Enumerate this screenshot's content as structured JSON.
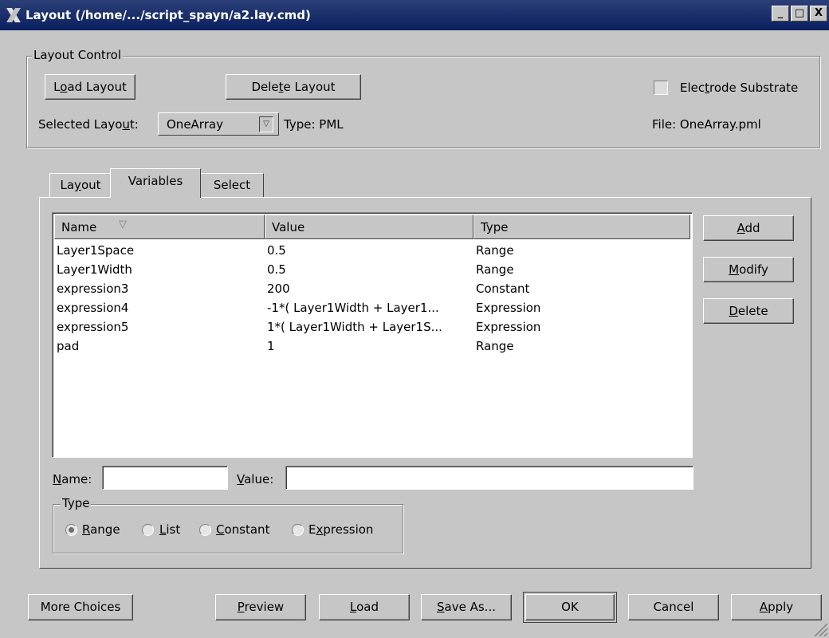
{
  "window": {
    "title": "Layout (/home/.../script_spayn/a2.lay.cmd)",
    "minimize": "_",
    "maximize": "□",
    "close": "X"
  },
  "layout_control": {
    "legend": "Layout Control",
    "load_layout": {
      "pre": "L",
      "u": "o",
      "post": "ad Layout"
    },
    "delete_layout": {
      "pre": "Dele",
      "u": "t",
      "post": "e Layout"
    },
    "electrode_substrate": {
      "pre": "Elec",
      "u": "t",
      "post": "rode Substrate"
    },
    "selected_layout_label": {
      "pre": "Selected Layo",
      "u": "u",
      "post": "t:"
    },
    "selected_layout_value": "OneArray",
    "type_text": "Type: PML",
    "file_text": "File: OneArray.pml"
  },
  "tabs": [
    {
      "pre": "La",
      "u": "y",
      "post": "out"
    },
    {
      "pre": "",
      "u": "",
      "post": "Variables"
    },
    {
      "pre": "",
      "u": "",
      "post": "Select"
    }
  ],
  "table": {
    "columns": [
      "Name",
      "Value",
      "Type"
    ],
    "rows": [
      {
        "name": "Layer1Space",
        "value": "0.5",
        "type": "Range"
      },
      {
        "name": "Layer1Width",
        "value": "0.5",
        "type": "Range"
      },
      {
        "name": "expression3",
        "value": "200",
        "type": "Constant"
      },
      {
        "name": "expression4",
        "value": "-1*( Layer1Width + Layer1...",
        "type": "Expression"
      },
      {
        "name": "expression5",
        "value": "1*( Layer1Width + Layer1S...",
        "type": "Expression"
      },
      {
        "name": "pad",
        "value": "1",
        "type": "Range"
      }
    ]
  },
  "side_buttons": {
    "add": {
      "pre": "",
      "u": "A",
      "post": "dd"
    },
    "modify": {
      "pre": "",
      "u": "M",
      "post": "odify"
    },
    "delete": {
      "pre": "",
      "u": "D",
      "post": "elete"
    }
  },
  "fields": {
    "name_label": {
      "pre": "",
      "u": "N",
      "post": "ame:"
    },
    "name_value": "",
    "value_label": {
      "pre": "",
      "u": "V",
      "post": "alue:"
    },
    "value_value": ""
  },
  "type_group": {
    "legend": "Type",
    "options": [
      {
        "pre": "",
        "u": "R",
        "post": "ange",
        "selected": true
      },
      {
        "pre": "",
        "u": "L",
        "post": "ist",
        "selected": false
      },
      {
        "pre": "",
        "u": "C",
        "post": "onstant",
        "selected": false
      },
      {
        "pre": "E",
        "u": "x",
        "post": "pression",
        "selected": false
      }
    ]
  },
  "bottom_buttons": {
    "more_choices": {
      "pre": "",
      "u": "",
      "post": "More Choices"
    },
    "preview": {
      "pre": "",
      "u": "P",
      "post": "review"
    },
    "load": {
      "pre": "",
      "u": "L",
      "post": "oad"
    },
    "save_as": {
      "pre": "",
      "u": "S",
      "post": "ave As..."
    },
    "ok": {
      "pre": "",
      "u": "",
      "post": "OK"
    },
    "cancel": {
      "pre": "",
      "u": "",
      "post": "Cancel"
    },
    "apply": {
      "pre": "",
      "u": "A",
      "post": "pply"
    }
  }
}
